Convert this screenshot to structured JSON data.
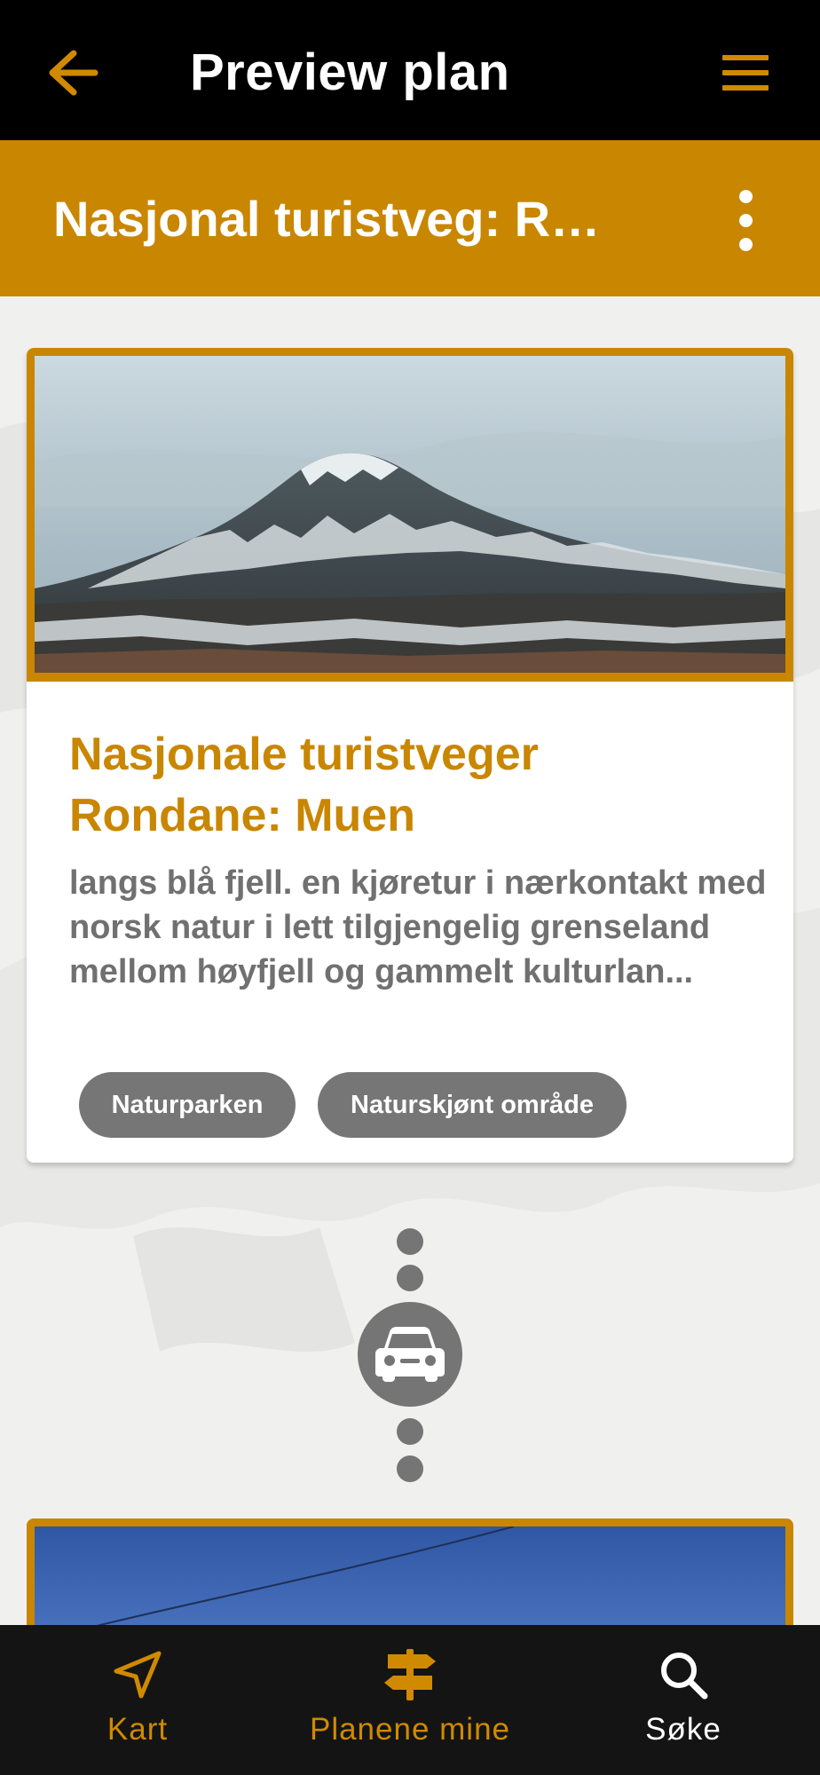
{
  "header": {
    "title": "Preview plan"
  },
  "plan": {
    "title": "Nasjonal turistveg: Rondane"
  },
  "card": {
    "title": "Nasjonale turistveger Rondane: Muen",
    "description": "langs blå fjell. en kjøretur i nærkontakt med norsk natur i lett tilgjengelig grenseland mellom høyfjell og gammelt kulturlan...",
    "tags": [
      "Naturparken",
      "Naturskjønt område"
    ]
  },
  "transport": {
    "mode": "car-icon"
  },
  "nav": {
    "items": [
      {
        "label": "Kart",
        "icon": "navigation-arrow-icon",
        "color": "#d08a00"
      },
      {
        "label": "Planene mine",
        "icon": "signpost-icon",
        "color": "#d08a00"
      },
      {
        "label": "Søke",
        "icon": "search-icon",
        "color": "#ffffff"
      }
    ]
  },
  "colors": {
    "accent": "#c98600",
    "topbar": "#000000",
    "navbar": "#141414",
    "tag": "#767676"
  }
}
